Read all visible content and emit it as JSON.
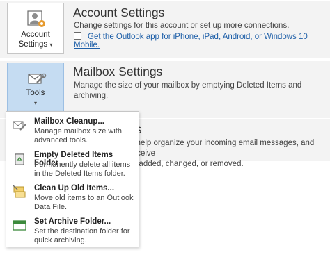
{
  "account": {
    "button_label": "Account",
    "button_label2": "Settings",
    "title": "Account Settings",
    "description": "Change settings for this account or set up more connections.",
    "link": "Get the Outlook app for iPhone, iPad, Android, or Windows 10 Mobile."
  },
  "mailbox": {
    "button_label": "Tools",
    "title": "Mailbox Settings",
    "description": "Manage the size of your mailbox by emptying Deleted Items and archiving."
  },
  "rules": {
    "title_fragment": "rts",
    "description_line1": "o help organize your incoming email messages, and receive",
    "description_line2": "re added, changed, or removed."
  },
  "menu": {
    "items": [
      {
        "title": "Mailbox Cleanup...",
        "desc": "Manage mailbox size with advanced tools.",
        "icon": "mailbox-cleanup-icon"
      },
      {
        "title": "Empty Deleted Items Folder",
        "desc": "Permanently delete all items in the Deleted Items folder.",
        "icon": "recycle-bin-icon"
      },
      {
        "title": "Clean Up Old Items...",
        "desc": "Move old items to an Outlook Data File.",
        "icon": "archive-folders-icon"
      },
      {
        "title": "Set Archive Folder...",
        "desc": "Set the destination folder for quick archiving.",
        "icon": "archive-folder-icon"
      }
    ]
  },
  "colors": {
    "accent": "#c5dcf2",
    "link": "#1e5fa8",
    "section_bg": "#f3f3f3"
  }
}
